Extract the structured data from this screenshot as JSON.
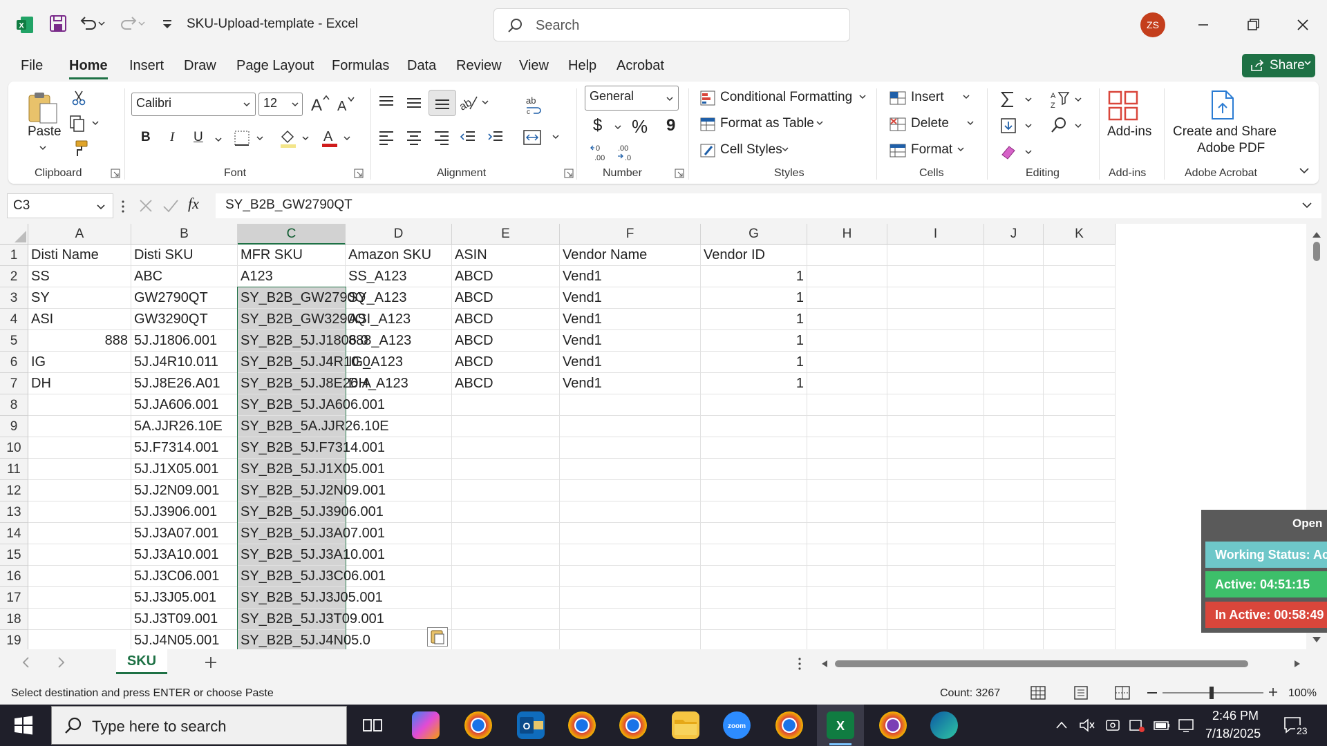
{
  "window": {
    "title": "SKU-Upload-template  -  Excel",
    "search_placeholder": "Search",
    "avatar_initials": "ZS"
  },
  "menu_tabs": [
    "File",
    "Home",
    "Insert",
    "Draw",
    "Page Layout",
    "Formulas",
    "Data",
    "Review",
    "View",
    "Help",
    "Acrobat"
  ],
  "share_label": "Share",
  "ribbon": {
    "clipboard": {
      "paste": "Paste",
      "label": "Clipboard"
    },
    "font": {
      "name": "Calibri",
      "size": "12",
      "label": "Font",
      "bold": "B",
      "italic": "I",
      "underline": "U"
    },
    "alignment": {
      "label": "Alignment"
    },
    "number": {
      "format": "General",
      "label": "Number",
      "currency": "$",
      "percent": "%",
      "comma": "9"
    },
    "styles": {
      "conditional": "Conditional Formatting",
      "table": "Format as Table",
      "cellstyles": "Cell Styles",
      "label": "Styles"
    },
    "cells": {
      "insert": "Insert",
      "delete": "Delete",
      "format": "Format",
      "label": "Cells"
    },
    "editing": {
      "label": "Editing"
    },
    "addins": {
      "button": "Add-ins",
      "label": "Add-ins"
    },
    "acrobat": {
      "line1": "Create and Share",
      "line2": "Adobe PDF",
      "label": "Adobe Acrobat"
    }
  },
  "formula_bar": {
    "name_box": "C3",
    "fx": "fx",
    "content": "SY_B2B_GW2790QT"
  },
  "columns": [
    "A",
    "B",
    "C",
    "D",
    "E",
    "F",
    "G",
    "H",
    "I",
    "J",
    "K"
  ],
  "rows": [
    [
      "Disti Name",
      "Disti SKU",
      "MFR SKU",
      "Amazon SKU",
      "ASIN",
      "Vendor Name",
      "Vendor ID",
      "",
      "",
      "",
      ""
    ],
    [
      "SS",
      "ABC",
      "A123",
      "SS_A123",
      "ABCD",
      "Vend1",
      "1",
      "",
      "",
      "",
      ""
    ],
    [
      "SY",
      "GW2790QT",
      "SY_B2B_GW2790Q",
      "SY_A123",
      "ABCD",
      "Vend1",
      "1",
      "",
      "",
      "",
      ""
    ],
    [
      "ASI",
      "GW3290QT",
      "SY_B2B_GW3290Q",
      "ASI_A123",
      "ABCD",
      "Vend1",
      "1",
      "",
      "",
      "",
      ""
    ],
    [
      "888",
      "5J.J1806.001",
      "SY_B2B_5J.J1806.0",
      "888_A123",
      "ABCD",
      "Vend1",
      "1",
      "",
      "",
      "",
      ""
    ],
    [
      "IG",
      "5J.J4R10.011",
      "SY_B2B_5J.J4R10.0",
      "IG_A123",
      "ABCD",
      "Vend1",
      "1",
      "",
      "",
      "",
      ""
    ],
    [
      "DH",
      "5J.J8E26.A01",
      "SY_B2B_5J.J8E26.A",
      "DH_A123",
      "ABCD",
      "Vend1",
      "1",
      "",
      "",
      "",
      ""
    ],
    [
      "",
      "5J.JA606.001",
      "SY_B2B_5J.JA606.001",
      "",
      "",
      "",
      "",
      "",
      "",
      "",
      ""
    ],
    [
      "",
      "5A.JJR26.10E",
      "SY_B2B_5A.JJR26.10E",
      "",
      "",
      "",
      "",
      "",
      "",
      "",
      ""
    ],
    [
      "",
      "5J.F7314.001",
      "SY_B2B_5J.F7314.001",
      "",
      "",
      "",
      "",
      "",
      "",
      "",
      ""
    ],
    [
      "",
      "5J.J1X05.001",
      "SY_B2B_5J.J1X05.001",
      "",
      "",
      "",
      "",
      "",
      "",
      "",
      ""
    ],
    [
      "",
      "5J.J2N09.001",
      "SY_B2B_5J.J2N09.001",
      "",
      "",
      "",
      "",
      "",
      "",
      "",
      ""
    ],
    [
      "",
      "5J.J3906.001",
      "SY_B2B_5J.J3906.001",
      "",
      "",
      "",
      "",
      "",
      "",
      "",
      ""
    ],
    [
      "",
      "5J.J3A07.001",
      "SY_B2B_5J.J3A07.001",
      "",
      "",
      "",
      "",
      "",
      "",
      "",
      ""
    ],
    [
      "",
      "5J.J3A10.001",
      "SY_B2B_5J.J3A10.001",
      "",
      "",
      "",
      "",
      "",
      "",
      "",
      ""
    ],
    [
      "",
      "5J.J3C06.001",
      "SY_B2B_5J.J3C06.001",
      "",
      "",
      "",
      "",
      "",
      "",
      "",
      ""
    ],
    [
      "",
      "5J.J3J05.001",
      "SY_B2B_5J.J3J05.001",
      "",
      "",
      "",
      "",
      "",
      "",
      "",
      ""
    ],
    [
      "",
      "5J.J3T09.001",
      "SY_B2B_5J.J3T09.001",
      "",
      "",
      "",
      "",
      "",
      "",
      "",
      ""
    ],
    [
      "",
      "5J.J4N05.001",
      "SY_B2B_5J.J4N05.0",
      "",
      "",
      "",
      "",
      "",
      "",
      "",
      ""
    ]
  ],
  "widget": {
    "open": "Open",
    "working": "Working Status: Ac",
    "active": "Active: 04:51:15",
    "inactive": "In Active: 00:58:49"
  },
  "sheet_tab": "SKU",
  "status": {
    "message": "Select destination and press ENTER or choose Paste",
    "count": "Count: 3267",
    "zoom": "100%"
  },
  "taskbar": {
    "search_placeholder": "Type here to search",
    "time": "2:46 PM",
    "date": "7/18/2025",
    "notifications": "23"
  },
  "colors": {
    "excel_green": "#1e7145",
    "active_green": "#3dbf6a",
    "inactive_red": "#d9463b",
    "working_teal": "#6ec7c9"
  }
}
